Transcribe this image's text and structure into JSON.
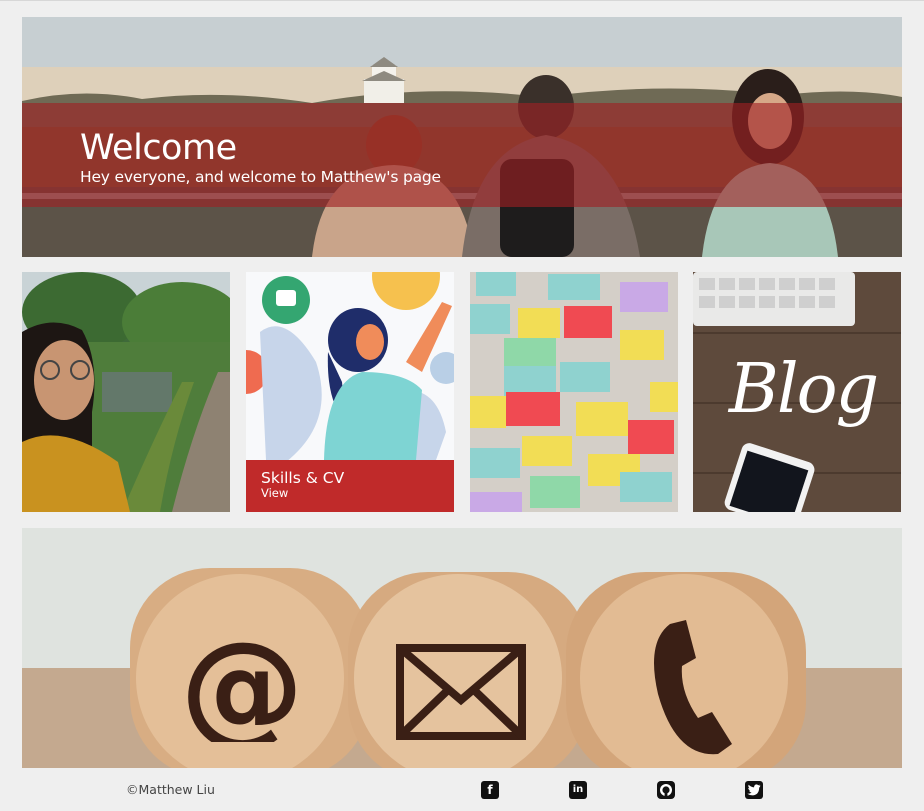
{
  "hero": {
    "title": "Welcome",
    "subtitle": "Hey everyone, and welcome to Matthew's page"
  },
  "tiles": [
    {
      "name": "portrait",
      "image": "portrait-garden-photo"
    },
    {
      "name": "skills",
      "image": "skills-illustration",
      "title": "Skills & CV",
      "link": "View"
    },
    {
      "name": "notes",
      "image": "sticky-notes-photo"
    },
    {
      "name": "blog",
      "image": "blog-desk-photo",
      "word": "Blog"
    }
  ],
  "contact": {
    "icons": [
      "at-sign-icon",
      "envelope-icon",
      "phone-icon"
    ]
  },
  "footer": {
    "copyright": "©Matthew Liu",
    "social": [
      "facebook-icon",
      "linkedin-icon",
      "github-icon",
      "twitter-icon"
    ]
  },
  "colors": {
    "accent": "#c02a2a",
    "background": "#efefef"
  }
}
